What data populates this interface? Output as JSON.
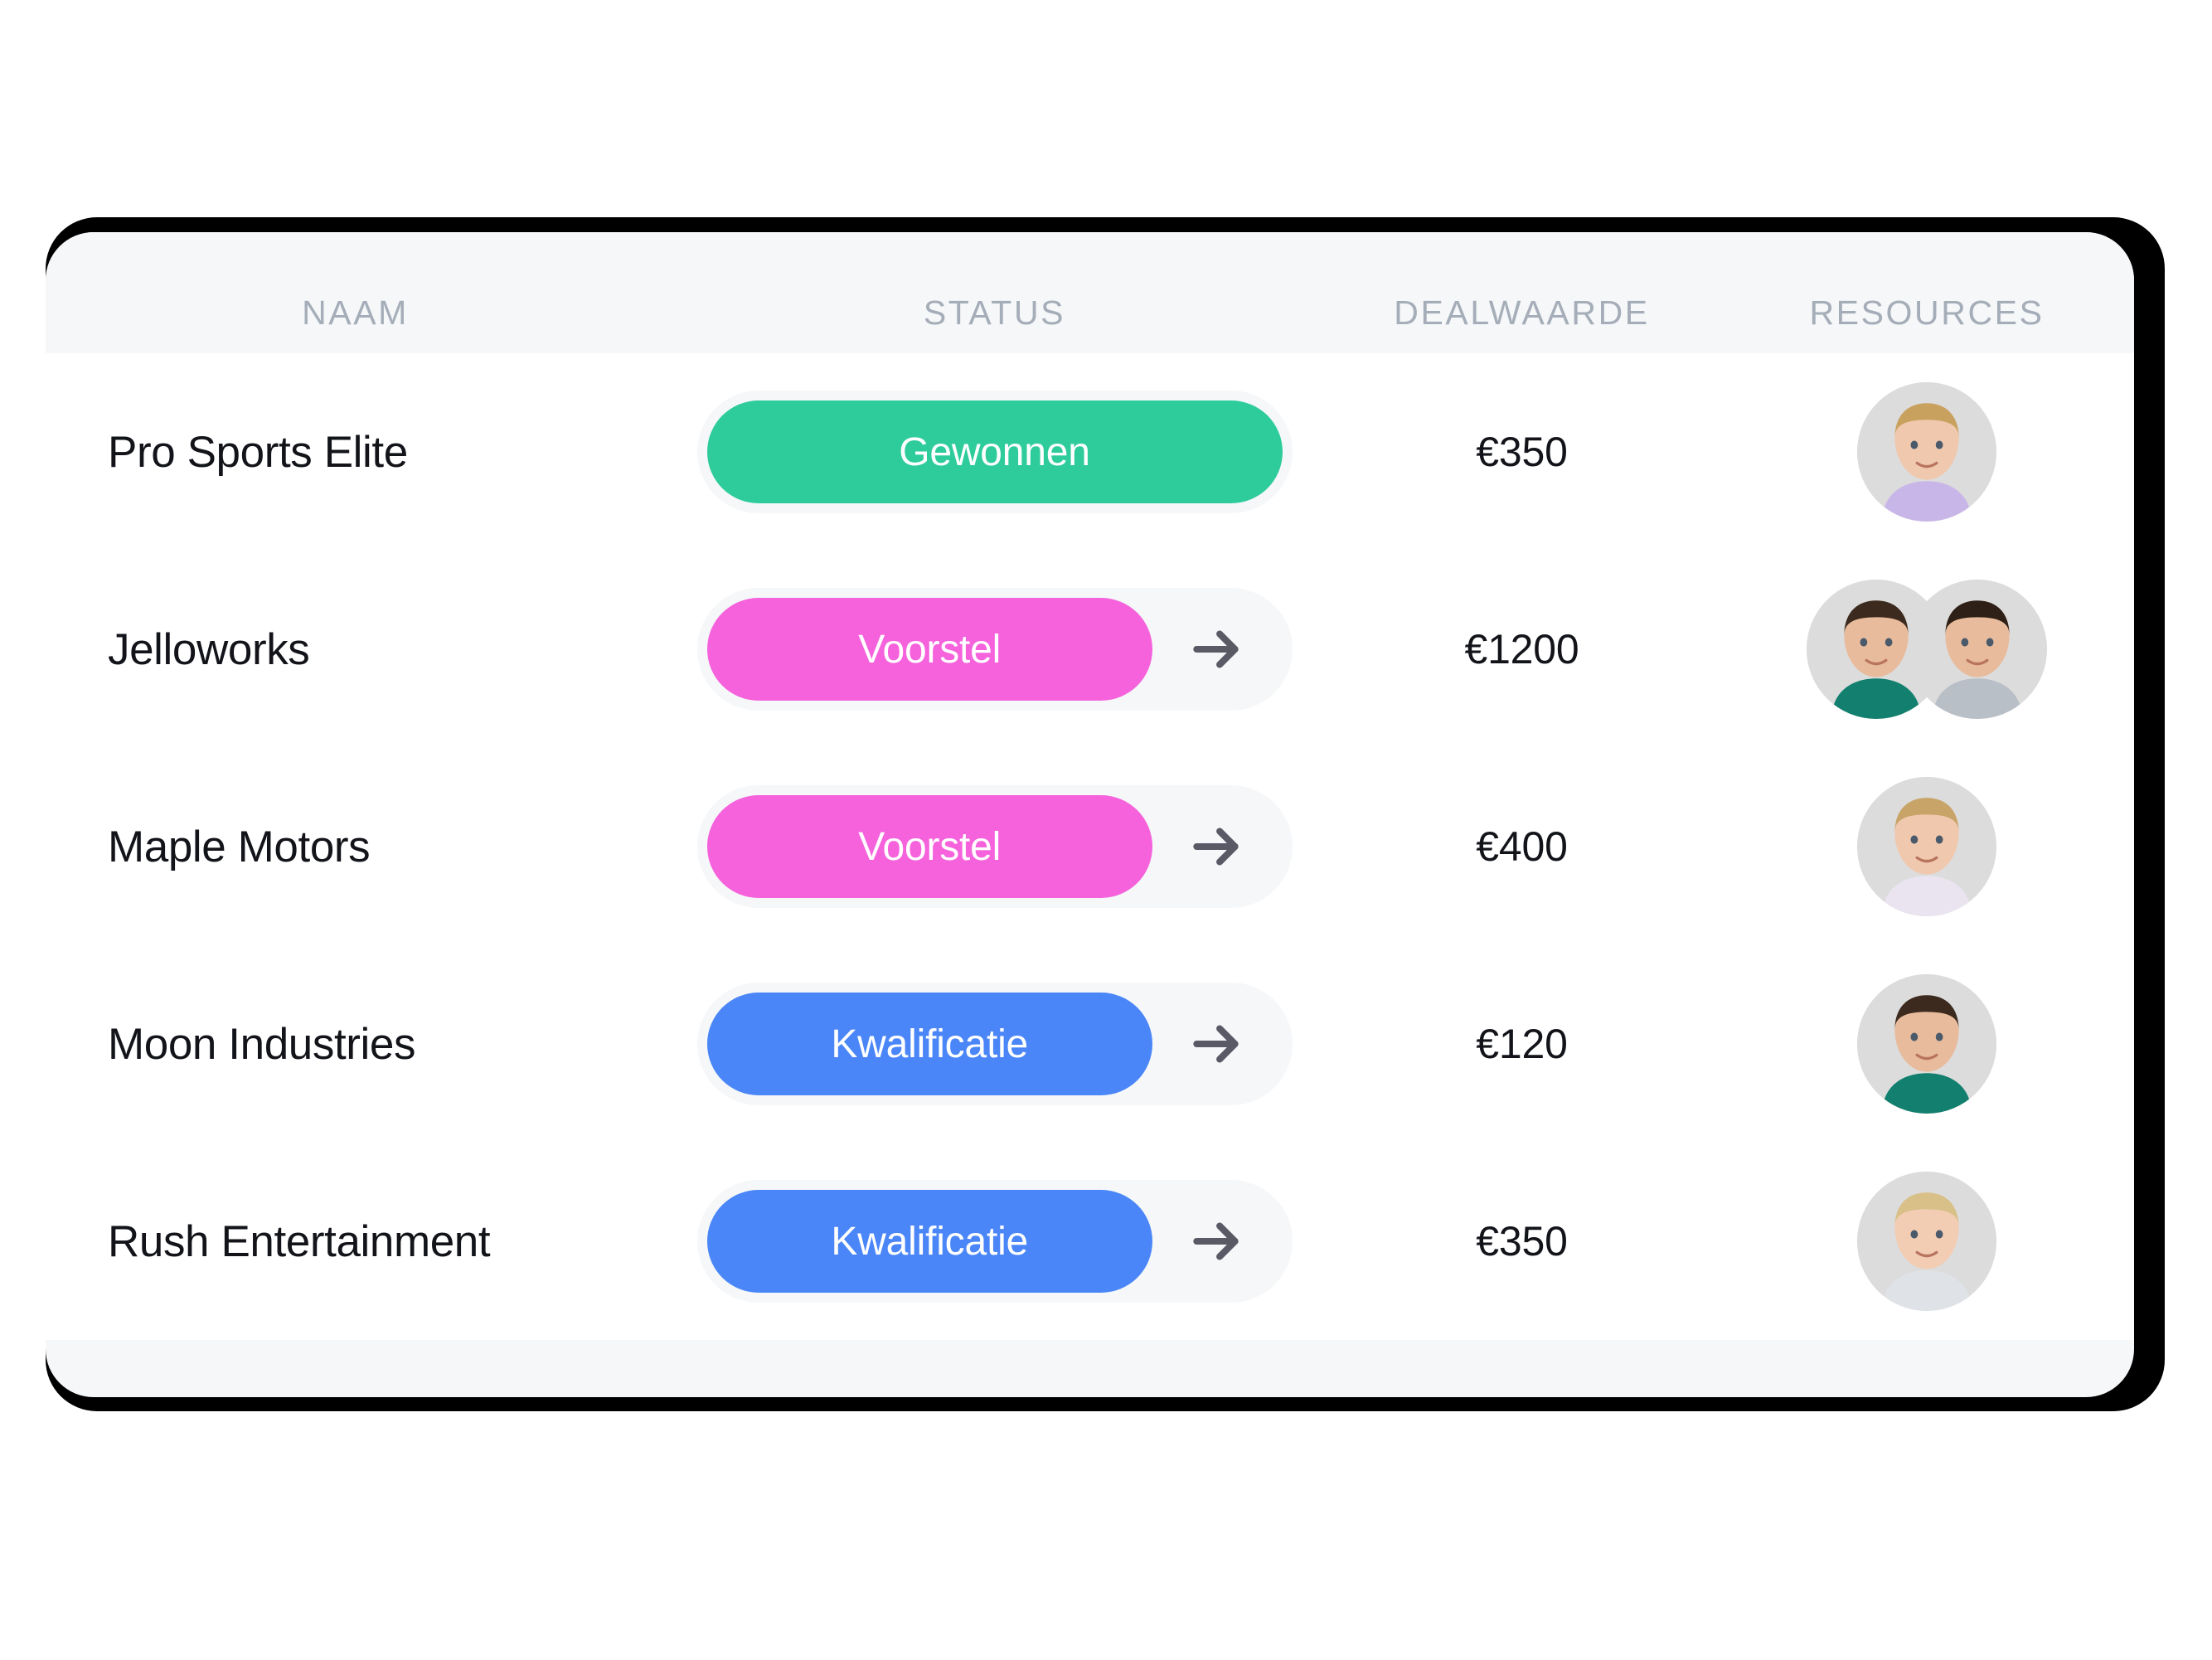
{
  "table": {
    "columns": [
      {
        "key": "naam",
        "label": "NAAM"
      },
      {
        "key": "status",
        "label": "STATUS"
      },
      {
        "key": "dealwaarde",
        "label": "DEALWAARDE"
      },
      {
        "key": "resources",
        "label": "RESOURCES"
      }
    ],
    "rows": [
      {
        "naam": "Pro Sports Elite",
        "status_label": "Gewonnen",
        "status_color": "#2ecc9b",
        "status_has_arrow": false,
        "dealwaarde": "€350",
        "resource_count": 1
      },
      {
        "naam": "Jelloworks",
        "status_label": "Voorstel",
        "status_color": "#f562dc",
        "status_has_arrow": true,
        "dealwaarde": "€1200",
        "resource_count": 2
      },
      {
        "naam": "Maple Motors",
        "status_label": "Voorstel",
        "status_color": "#f562dc",
        "status_has_arrow": true,
        "dealwaarde": "€400",
        "resource_count": 1
      },
      {
        "naam": "Moon Industries",
        "status_label": "Kwalificatie",
        "status_color": "#4a86f7",
        "status_has_arrow": true,
        "dealwaarde": "€120",
        "resource_count": 1
      },
      {
        "naam": "Rush Entertainment",
        "status_label": "Kwalificatie",
        "status_color": "#4a86f7",
        "status_has_arrow": true,
        "dealwaarde": "€350",
        "resource_count": 1
      }
    ]
  },
  "icons": {
    "arrow": "arrow-right-icon",
    "avatar": "avatar-icon"
  },
  "colors": {
    "status_won": "#2ecc9b",
    "status_proposal": "#f562dc",
    "status_qualification": "#4a86f7",
    "track": "#f5f7f9",
    "arrow": "#5a5a66",
    "header_text": "#a5adb8",
    "body_text": "#12141a",
    "divider": "#eef1f4",
    "bezel": "#000000",
    "card": "#f5f7f9",
    "table_body": "#ffffff",
    "avatar_bg": "#dcdcdc"
  }
}
